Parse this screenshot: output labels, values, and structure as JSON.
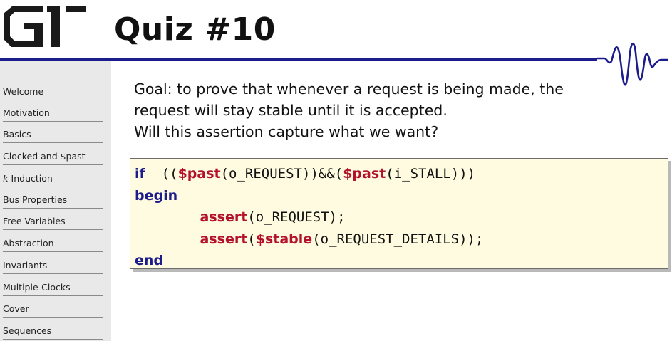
{
  "header": {
    "title": "Quiz #10",
    "logo_name": "gt-logo",
    "accent_color": "#1c1c8c"
  },
  "sidebar": {
    "items": [
      {
        "label": "Welcome"
      },
      {
        "label": "Motivation"
      },
      {
        "label": "Basics"
      },
      {
        "label": "Clocked and $past"
      },
      {
        "prefix": "k",
        "label": " Induction"
      },
      {
        "label": "Bus Properties"
      },
      {
        "label": "Free Variables"
      },
      {
        "label": "Abstraction"
      },
      {
        "label": "Invariants"
      },
      {
        "label": "Multiple-Clocks"
      },
      {
        "label": "Cover"
      },
      {
        "label": "Sequences"
      }
    ]
  },
  "content": {
    "goal_lines": [
      "Goal: to prove that whenever a request is being made, the",
      "request will stay stable until it is accepted.",
      "Will this assertion capture what we want?"
    ],
    "code": {
      "line1": {
        "kw_if": "if",
        "open": "((",
        "sys1": "$past",
        "arg1": "(o_REQUEST))&&(",
        "sys2": "$past",
        "arg2": "(i_STALL)))"
      },
      "line2": {
        "kw_begin": "begin"
      },
      "line3": {
        "indent": "        ",
        "kw_assert": "assert",
        "arg": "(o_REQUEST);"
      },
      "line4": {
        "indent": "        ",
        "kw_assert": "assert",
        "open": "(",
        "sys": "$stable",
        "arg": "(o_REQUEST_DETAILS));"
      },
      "line5": {
        "kw_end": "end"
      }
    }
  }
}
